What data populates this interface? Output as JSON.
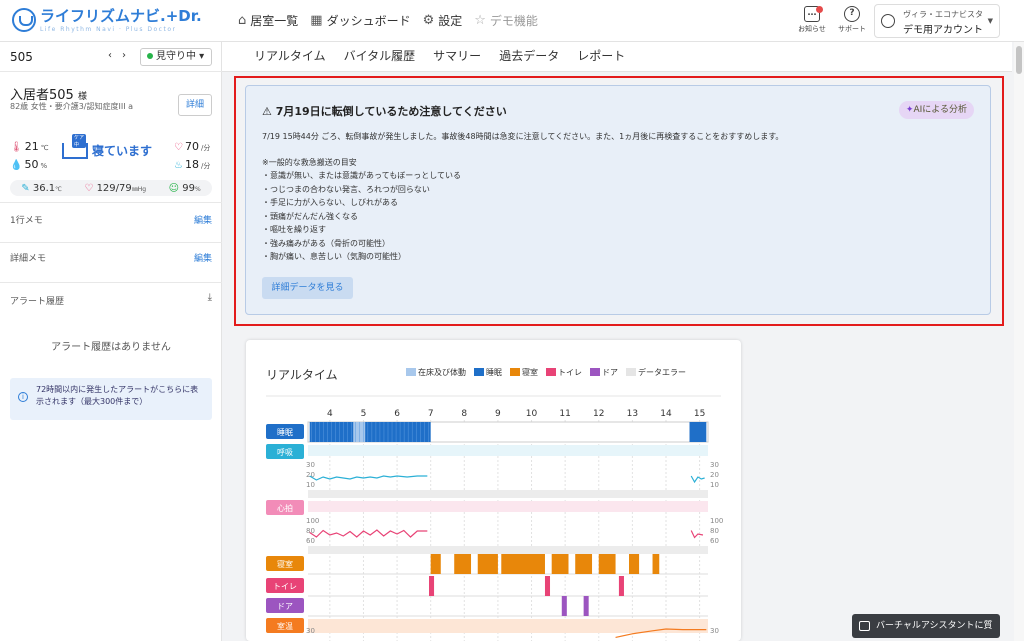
{
  "header": {
    "logo_text": "ライフリズムナビ.+Dr.",
    "logo_sub": "Life Rhythm Navi · Plus Doctor",
    "nav": [
      {
        "label": "居室一覧",
        "icon": "home-icon"
      },
      {
        "label": "ダッシュボード",
        "icon": "grid-icon"
      },
      {
        "label": "設定",
        "icon": "gear-icon"
      },
      {
        "label": "デモ機能",
        "icon": "star-icon"
      }
    ],
    "notice_label": "お知らせ",
    "support_label": "サポート",
    "account_line1": "ヴィラ・エコナビスタ",
    "account_line2": "デモ用アカウント"
  },
  "sidebar": {
    "room": "505",
    "watch_status": "見守り中",
    "resident_name": "入居者505",
    "honorific": "様",
    "resident_info": "82歳 女性・要介護3/認知症度III a",
    "detail_label": "詳細",
    "temp": "21",
    "temp_unit": "℃",
    "humidity": "50",
    "humidity_unit": "%",
    "sleep_tag": "ケア中",
    "sleep_status": "寝ています",
    "heart": "70",
    "heart_unit": "/分",
    "resp": "18",
    "resp_unit": "/分",
    "body_temp": "36.1",
    "body_temp_unit": "℃",
    "bp": "129/79",
    "bp_unit": "㎜Hg",
    "spo2": "99",
    "spo2_unit": "%",
    "memo1_label": "1行メモ",
    "memo2_label": "詳細メモ",
    "edit_label": "編集",
    "alert_history_label": "アラート履歴",
    "no_alert": "アラート履歴はありません",
    "alert_info": "72時間以内に発生したアラートがこちらに表示されます（最大300件まで）"
  },
  "tabs": [
    "リアルタイム",
    "バイタル履歴",
    "サマリー",
    "過去データ",
    "レポート"
  ],
  "notice": {
    "title": "7月19日に転倒しているため注意してください",
    "ai_label": "AIによる分析",
    "lead": "7/19 15時44分 ごろ、転倒事故が発生しました。事故後48時間は急変に注意してください。また、1ヵ月後に再検査することをおすすめします。",
    "guide_title": "※一般的な救急搬送の目安",
    "items": [
      "・意識が無い、または意識があってもぼーっとしている",
      "・つじつまの合わない発言、ろれつが回らない",
      "・手足に力が入らない、しびれがある",
      "・頭痛がだんだん強くなる",
      "・嘔吐を繰り返す",
      "・強み痛みがある（骨折の可能性）",
      "・胸が痛い、息苦しい（気胸の可能性）"
    ],
    "detail_button": "詳細データを見る"
  },
  "chart_card": {
    "title": "リアルタイム",
    "legend": [
      {
        "label": "在床及び体動",
        "color": "#a8c8ec"
      },
      {
        "label": "睡眠",
        "color": "#1f6fc8"
      },
      {
        "label": "寝室",
        "color": "#e8870a"
      },
      {
        "label": "トイレ",
        "color": "#e84376"
      },
      {
        "label": "ドア",
        "color": "#9c55c0"
      },
      {
        "label": "データエラー",
        "color": "#e5e5e5"
      }
    ]
  },
  "chart_data": {
    "type": "timeline",
    "hours": [
      4,
      5,
      6,
      7,
      8,
      9,
      10,
      11,
      12,
      13,
      14,
      15
    ],
    "rows": [
      {
        "label": "睡眠",
        "color": "#1f6fc8"
      },
      {
        "label": "呼吸",
        "color": "#2bb0d6",
        "scale": [
          "30",
          "20",
          "10"
        ]
      },
      {
        "label": "心拍",
        "color": "#f28cb8",
        "scale": [
          "100",
          "80",
          "60"
        ]
      },
      {
        "label": "寝室",
        "color": "#e8870a"
      },
      {
        "label": "トイレ",
        "color": "#e84376"
      },
      {
        "label": "ドア",
        "color": "#9c55c0"
      },
      {
        "label": "室温",
        "color": "#f47b20",
        "scale": [
          "30"
        ]
      }
    ],
    "sleep_segments": [
      [
        3.4,
        4.7,
        "sleep"
      ],
      [
        4.7,
        5.05,
        "bed"
      ],
      [
        5.05,
        7.0,
        "sleep"
      ],
      [
        14.7,
        15.2,
        "sleep"
      ]
    ],
    "resp_points": [
      [
        3.4,
        18
      ],
      [
        3.6,
        14
      ],
      [
        3.8,
        17
      ],
      [
        4.0,
        15
      ],
      [
        4.2,
        17
      ],
      [
        4.4,
        16
      ],
      [
        4.6,
        15
      ],
      [
        4.8,
        17
      ],
      [
        5.0,
        16
      ],
      [
        5.2,
        17
      ],
      [
        5.4,
        16
      ],
      [
        5.6,
        18
      ],
      [
        5.8,
        17
      ],
      [
        6.0,
        18
      ],
      [
        6.3,
        17
      ],
      [
        6.6,
        18
      ],
      [
        6.9,
        18
      ],
      [
        14.75,
        18
      ],
      [
        14.85,
        12
      ],
      [
        14.95,
        17
      ],
      [
        15.05,
        15
      ],
      [
        15.15,
        16
      ]
    ],
    "heart_points": [
      [
        3.4,
        75
      ],
      [
        3.6,
        66
      ],
      [
        3.8,
        79
      ],
      [
        4.0,
        70
      ],
      [
        4.2,
        74
      ],
      [
        4.4,
        68
      ],
      [
        4.6,
        77
      ],
      [
        4.8,
        66
      ],
      [
        5.0,
        78
      ],
      [
        5.2,
        70
      ],
      [
        5.4,
        80
      ],
      [
        5.6,
        68
      ],
      [
        5.8,
        78
      ],
      [
        6.0,
        72
      ],
      [
        6.2,
        79
      ],
      [
        6.4,
        66
      ],
      [
        6.6,
        78
      ],
      [
        6.9,
        78
      ],
      [
        14.75,
        79
      ],
      [
        14.85,
        65
      ],
      [
        14.95,
        72
      ],
      [
        15.1,
        70
      ]
    ],
    "bedroom_segments": [
      [
        7.0,
        7.3
      ],
      [
        7.7,
        8.2
      ],
      [
        8.4,
        9.0
      ],
      [
        9.1,
        10.4
      ],
      [
        10.6,
        11.1
      ],
      [
        11.3,
        11.8
      ],
      [
        12.0,
        12.5
      ],
      [
        12.9,
        13.2
      ],
      [
        13.6,
        13.8
      ]
    ],
    "toilet_segments": [
      [
        6.95,
        7.1
      ],
      [
        10.4,
        10.55
      ],
      [
        12.6,
        12.75
      ]
    ],
    "door_segments": [
      [
        10.9,
        11.05
      ],
      [
        11.55,
        11.7
      ]
    ],
    "room_temp_points": [
      [
        12.5,
        28.6
      ],
      [
        13.0,
        29.2
      ],
      [
        13.6,
        29.7
      ],
      [
        14.0,
        30.0
      ],
      [
        14.5,
        29.9
      ],
      [
        15.2,
        29.9
      ]
    ]
  }
}
